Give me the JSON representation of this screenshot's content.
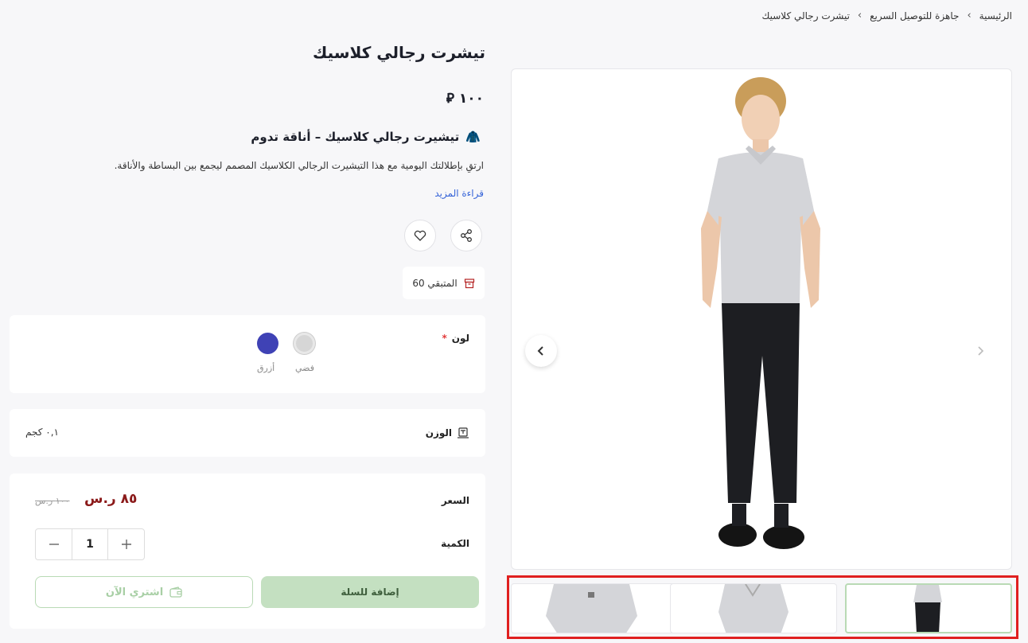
{
  "breadcrumb": {
    "home": "الرئيسية",
    "category": "جاهزة للتوصيل السريع",
    "current": "تيشرت رجالي كلاسيك"
  },
  "product": {
    "title": "تيشرت رجالي كلاسيك",
    "price_top": "١٠٠ ⃁",
    "heading_emoji": "🧥",
    "heading": "تيشيرت رجالي كلاسيك – أناقة تدوم",
    "description": "ارتقِ بإطلالتك اليومية مع هذا التيشيرت الرجالي الكلاسيك المصمم ليجمع بين البساطة والأناقة.",
    "read_more": "قراءة المزيد",
    "stock": "المتبقي 60"
  },
  "color": {
    "label": "لون",
    "required_mark": "*",
    "options": [
      {
        "name": "فضي",
        "hex": "#d6d6d6"
      },
      {
        "name": "أزرق",
        "hex": "#3f42b5"
      }
    ]
  },
  "weight": {
    "label": "الوزن",
    "value": "٠,١ كجم"
  },
  "pricing": {
    "label": "السعر",
    "current": "٨٥ ر.س",
    "original": "١٠٠ ر.س"
  },
  "quantity": {
    "label": "الكمية",
    "value": "1"
  },
  "actions": {
    "add_to_cart": "إضافة للسلة",
    "buy_now": "اشتري الآن"
  },
  "colors": {
    "accent_green": "#c4e0c1",
    "price_red": "#8b1a1a",
    "link_blue": "#3563d8",
    "highlight_red": "#e02020"
  }
}
